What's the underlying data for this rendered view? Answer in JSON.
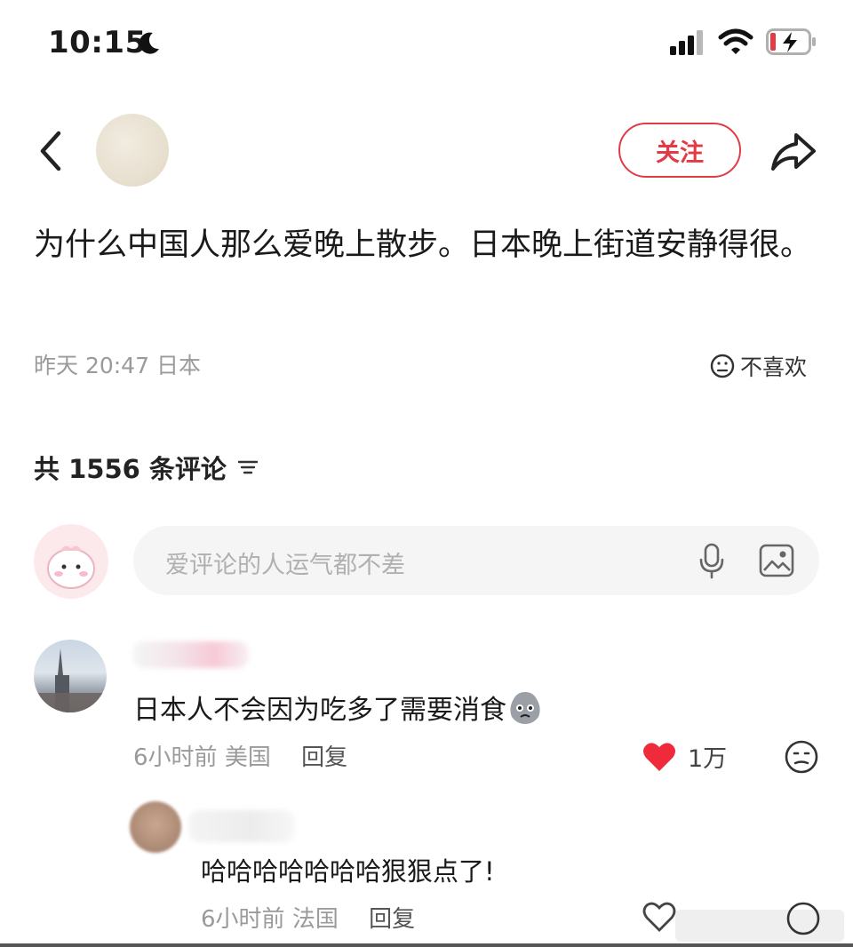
{
  "status_bar": {
    "time": "10:15",
    "icons": [
      "moon-icon",
      "signal-icon",
      "wifi-icon",
      "battery-charging-icon"
    ],
    "battery_color": "#e23b46"
  },
  "header": {
    "follow_label": "关注",
    "accent_color": "#e23b46"
  },
  "post": {
    "text": "为什么中国人那么爱晚上散步。日本晚上街道安静得很。",
    "time": "昨天 20:47",
    "location": "日本",
    "dislike_label": "不喜欢"
  },
  "comments_section": {
    "count_label": "共 1556 条评论",
    "input_placeholder": "爱评论的人运气都不差"
  },
  "comments": [
    {
      "text": "日本人不会因为吃多了需要消食",
      "time": "6小时前",
      "location": "美国",
      "reply_label": "回复",
      "likes": "1万",
      "liked": true
    },
    {
      "text": "哈哈哈哈哈哈哈狠狠点了!",
      "time": "6小时前",
      "location": "法国",
      "reply_label": "回复"
    }
  ]
}
